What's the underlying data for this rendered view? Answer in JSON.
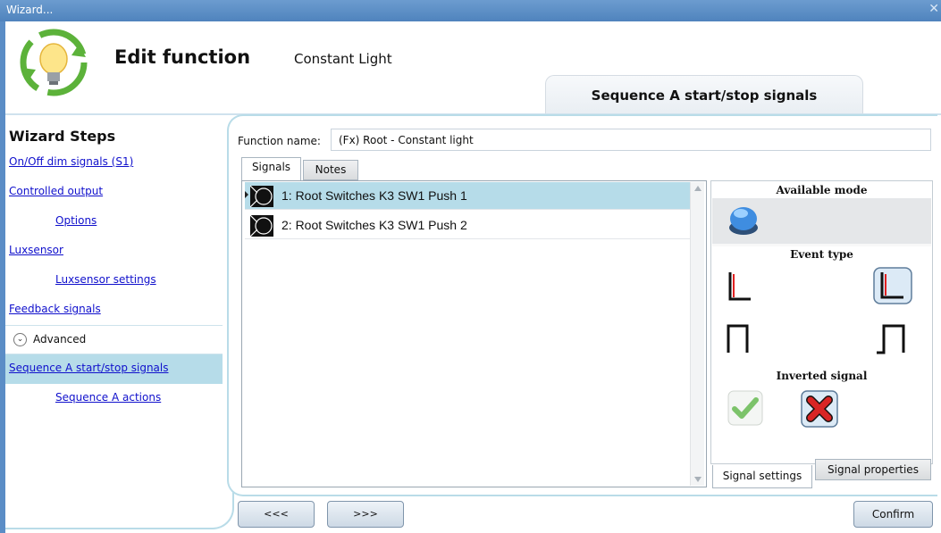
{
  "window": {
    "title": "Wizard...",
    "close_glyph": "✕"
  },
  "header": {
    "title": "Edit function",
    "subtitle": "Constant Light",
    "step_tab": "Sequence A start/stop signals",
    "logo_icon": "lightbulb-cycle-icon"
  },
  "sidebar": {
    "title": "Wizard Steps",
    "items": [
      {
        "label": "On/Off dim signals (S1)",
        "indent": 0,
        "selected": false
      },
      {
        "label": "Controlled output",
        "indent": 0,
        "selected": false
      },
      {
        "label": "Options",
        "indent": 1,
        "selected": false
      },
      {
        "label": "Luxsensor",
        "indent": 0,
        "selected": false
      },
      {
        "label": "Luxsensor settings",
        "indent": 1,
        "selected": false
      },
      {
        "label": "Feedback signals",
        "indent": 0,
        "selected": false
      },
      {
        "label": "Sequence A start/stop signals",
        "indent": 0,
        "selected": true
      },
      {
        "label": "Sequence A actions",
        "indent": 1,
        "selected": false
      }
    ],
    "advanced_label": "Advanced",
    "advanced_icon": "chevron-down-icon"
  },
  "form": {
    "function_name_label": "Function name:",
    "function_name_value": "(Fx) Root - Constant light"
  },
  "tabs": {
    "signals": "Signals",
    "notes": "Notes"
  },
  "signals": [
    {
      "label": "1: Root Switches K3 SW1 Push 1",
      "selected": true
    },
    {
      "label": "2: Root Switches K3 SW1 Push 2",
      "selected": false
    }
  ],
  "properties": {
    "available_mode": "Available mode",
    "event_type": "Event type",
    "inverted_signal": "Inverted signal",
    "tab_settings": "Signal settings",
    "tab_properties": "Signal properties"
  },
  "buttons": {
    "prev": "<<<",
    "next": ">>>",
    "confirm": "Confirm"
  },
  "colors": {
    "title_bar": "#5b8dc6",
    "selection": "#b6dce9",
    "link": "#1010cc",
    "frame_border": "#b9dce8"
  }
}
